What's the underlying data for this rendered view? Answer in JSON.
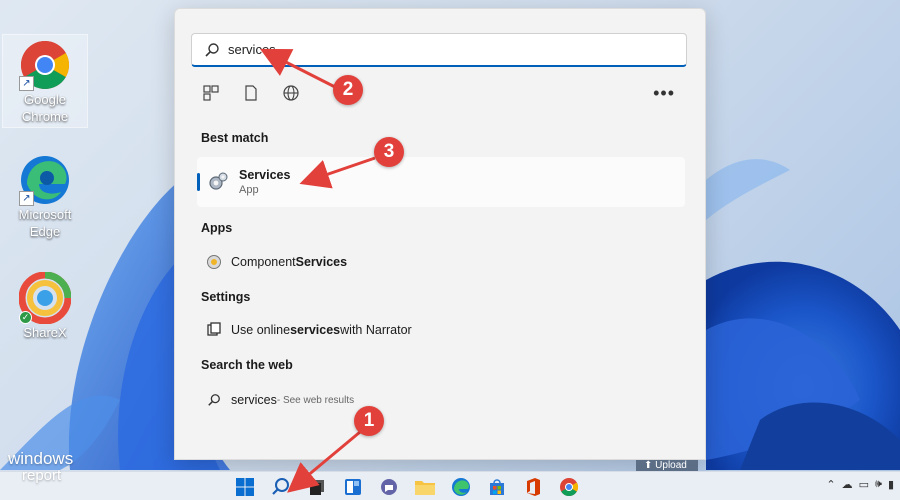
{
  "desktop": {
    "icons": [
      {
        "label_line1": "Google",
        "label_line2": "Chrome",
        "icon": "chrome-icon"
      },
      {
        "label_line1": "Microsoft",
        "label_line2": "Edge",
        "icon": "edge-icon"
      },
      {
        "label_line1": "ShareX",
        "icon": "sharex-icon"
      }
    ]
  },
  "search": {
    "value": "services",
    "placeholder": ""
  },
  "filters": [
    "apps-filter-icon",
    "documents-filter-icon",
    "web-filter-icon"
  ],
  "more_label": "•••",
  "best_match": {
    "heading": "Best match",
    "title": "Services",
    "subtitle": "App"
  },
  "apps": {
    "heading": "Apps",
    "item_prefix": "Component ",
    "item_bold": "Services"
  },
  "settings": {
    "heading": "Settings",
    "item_prefix": "Use online ",
    "item_bold": "services",
    "item_suffix": " with Narrator"
  },
  "web": {
    "heading": "Search the web",
    "query": "services",
    "hint": " - See web results"
  },
  "taskbar": {
    "icons": [
      "windows-start-icon",
      "search-icon",
      "task-view-icon",
      "widgets-icon",
      "teams-chat-icon",
      "file-explorer-icon",
      "edge-icon",
      "store-icon",
      "office-icon",
      "chrome-icon"
    ],
    "upload_label": "Upload"
  },
  "tray": [
    "chevron-up-icon",
    "onedrive-icon",
    "display-icon",
    "volume-icon",
    "battery-icon"
  ],
  "annotations": {
    "step1": "1",
    "step2": "2",
    "step3": "3"
  },
  "watermark": {
    "line1": "windows",
    "line2": "report"
  },
  "colors": {
    "accent": "#005fb8",
    "annotation_red": "#e2403b"
  }
}
